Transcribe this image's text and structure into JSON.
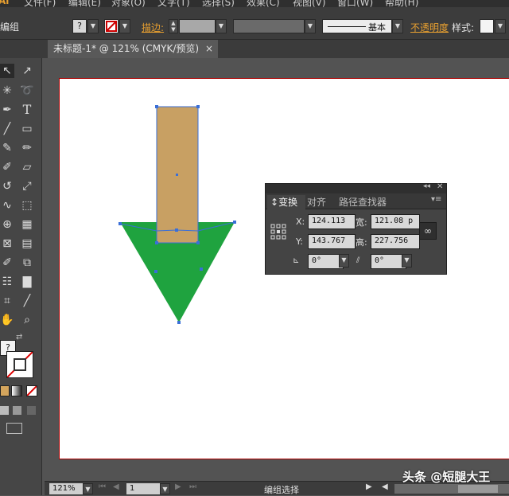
{
  "menu": {
    "items": [
      "文件(F)",
      "编辑(E)",
      "对象(O)",
      "文字(T)",
      "选择(S)",
      "效果(C)",
      "视图(V)",
      "窗口(W)",
      "帮助(H)"
    ]
  },
  "control_bar": {
    "selection_label": "编组",
    "fill_placeholder": "?",
    "stroke_label": "描边:",
    "stroke_style_label": "基本",
    "opacity_label": "不透明度",
    "style_label": "样式:"
  },
  "document_tab": {
    "title": "未标题-1* @ 121% (CMYK/预览)",
    "close": "×"
  },
  "toolbox": {
    "icons": [
      "selection-icon",
      "direct-selection-icon",
      "magic-wand-icon",
      "lasso-icon",
      "pen-icon",
      "type-icon",
      "line-icon",
      "rectangle-icon",
      "paintbrush-icon",
      "pencil-icon",
      "blob-brush-icon",
      "eraser-icon",
      "rotate-icon",
      "scale-icon",
      "warp-icon",
      "free-transform-icon",
      "shape-builder-icon",
      "perspective-icon",
      "mesh-icon",
      "gradient-icon",
      "eyedropper-icon",
      "blend-icon",
      "symbol-sprayer-icon",
      "graph-icon",
      "artboard-icon",
      "slice-icon",
      "hand-icon",
      "zoom-icon"
    ],
    "fill_question": "?"
  },
  "artwork": {
    "shaft_color": "#c8a063",
    "head_color": "#1fa33f",
    "selection_color": "#3a6fd8"
  },
  "transform_panel": {
    "tabs": [
      "变换",
      "对齐",
      "路径查找器"
    ],
    "x_label": "X:",
    "x_value": "124.113",
    "y_label": "Y:",
    "y_value": "143.767",
    "w_label": "宽:",
    "w_value": "121.08 p",
    "h_label": "高:",
    "h_value": "227.756",
    "rotate_value": "0°",
    "shear_value": "0°"
  },
  "status_bar": {
    "zoom": "121%",
    "page": "1",
    "status": "编组选择"
  },
  "watermark": "头条 @短腿大王"
}
